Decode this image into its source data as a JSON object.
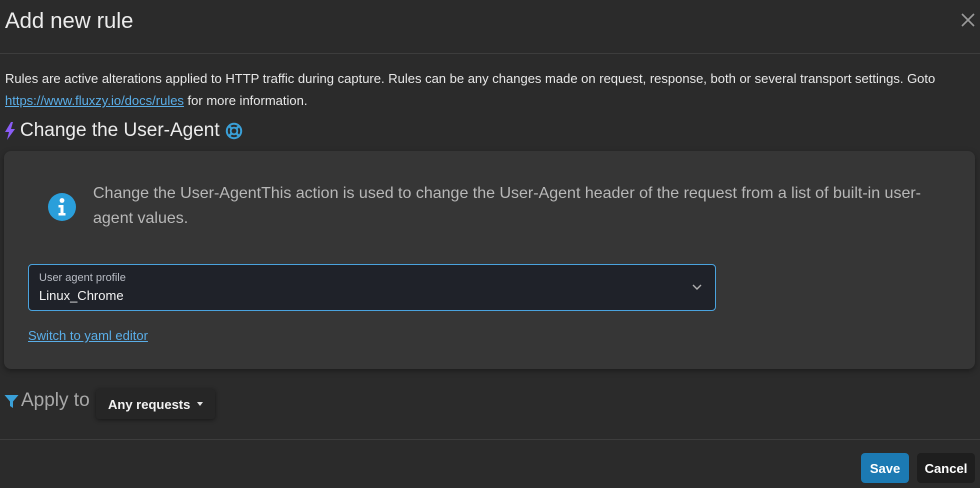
{
  "dialog": {
    "title": "Add new rule",
    "close_icon": "close-icon"
  },
  "description": {
    "text": "Rules are active alterations applied to HTTP traffic during capture. Rules can be any changes made on request, response, both or several transport settings. Goto ",
    "link": "https://www.fluxzy.io/docs/rules",
    "suffix": " for more information."
  },
  "action": {
    "title": "Change the User-Agent",
    "title_icon": "lightning-bolt-icon",
    "help_icon": "lifebuoy-icon",
    "info_icon": "info-circle-icon",
    "info_text": "Change the User-AgentThis action is used to change the User-Agent header of the request from a list of built-in user-agent values."
  },
  "profile_select": {
    "label": "User agent profile",
    "value": "Linux_Chrome",
    "icon": "chevron-down-icon"
  },
  "yaml_link": "Switch to yaml editor",
  "apply": {
    "icon": "filter-icon",
    "label": "Apply to",
    "filter_button": "Any requests"
  },
  "footer": {
    "save_label": "Save",
    "cancel_label": "Cancel"
  },
  "colors": {
    "accent": "#1c7ab3",
    "link": "#5aaee8",
    "bolt": "#8a5cf6",
    "filter": "#3aa0d8",
    "focus_border": "#4aa3de"
  }
}
